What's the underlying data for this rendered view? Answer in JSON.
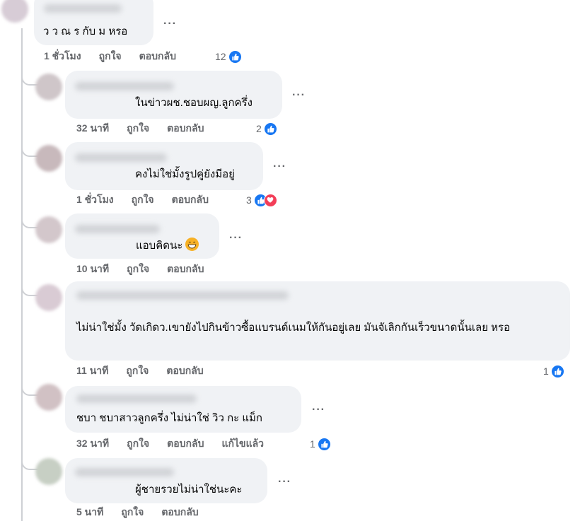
{
  "comments": [
    {
      "text": "ว ว ณ ร กับ ม หรอ",
      "time": "1 ชั่วโมง",
      "like": "ถูกใจ",
      "reply": "ตอบกลับ",
      "count": "12"
    },
    {
      "text": "ในข่าวผช.ชอบผญ.ลูกครึ่ง",
      "time": "32 นาที",
      "like": "ถูกใจ",
      "reply": "ตอบกลับ",
      "count": "2"
    },
    {
      "text": "คงไม่ใช่มั้งรูปคู่ยังมีอยู่",
      "time": "1 ชั่วโมง",
      "like": "ถูกใจ",
      "reply": "ตอบกลับ",
      "count": "3"
    },
    {
      "text": "แอบคิดนะ",
      "time": "10 นาที",
      "like": "ถูกใจ",
      "reply": "ตอบกลับ"
    },
    {
      "text": "ไม่น่าใช่มั้ง วัดเกิดว.เขายังไปกินข้าวซื้อแบรนด์เนมให้กันอยู่เลย มันจัเลิกกันเร็วขนาดนั้นเลย หรอ",
      "time": "11 นาที",
      "like": "ถูกใจ",
      "reply": "ตอบกลับ",
      "count": "1"
    },
    {
      "text": "ชบา ชบาสาวลูกครึ่ง ไม่น่าใช่ วิว กะ แม็ก",
      "time": "32 นาที",
      "like": "ถูกใจ",
      "reply": "ตอบกลับ",
      "edited": "แก้ไขแล้ว",
      "count": "1"
    },
    {
      "text": "ผู้ชายรวยไม่น่าใช่นะคะ",
      "time": "5 นาที",
      "like": "ถูกใจ",
      "reply": "ตอบกลับ"
    }
  ],
  "more_label": "···",
  "icons": {
    "like": "thumbs-up-icon",
    "love": "heart-icon",
    "emoji": "grinning-face-icon",
    "more": "more-options-icon"
  },
  "colors": {
    "like_blue": "#1877f2",
    "love_red": "#f33e58",
    "bubble": "#f0f2f5",
    "meta": "#65676b"
  }
}
